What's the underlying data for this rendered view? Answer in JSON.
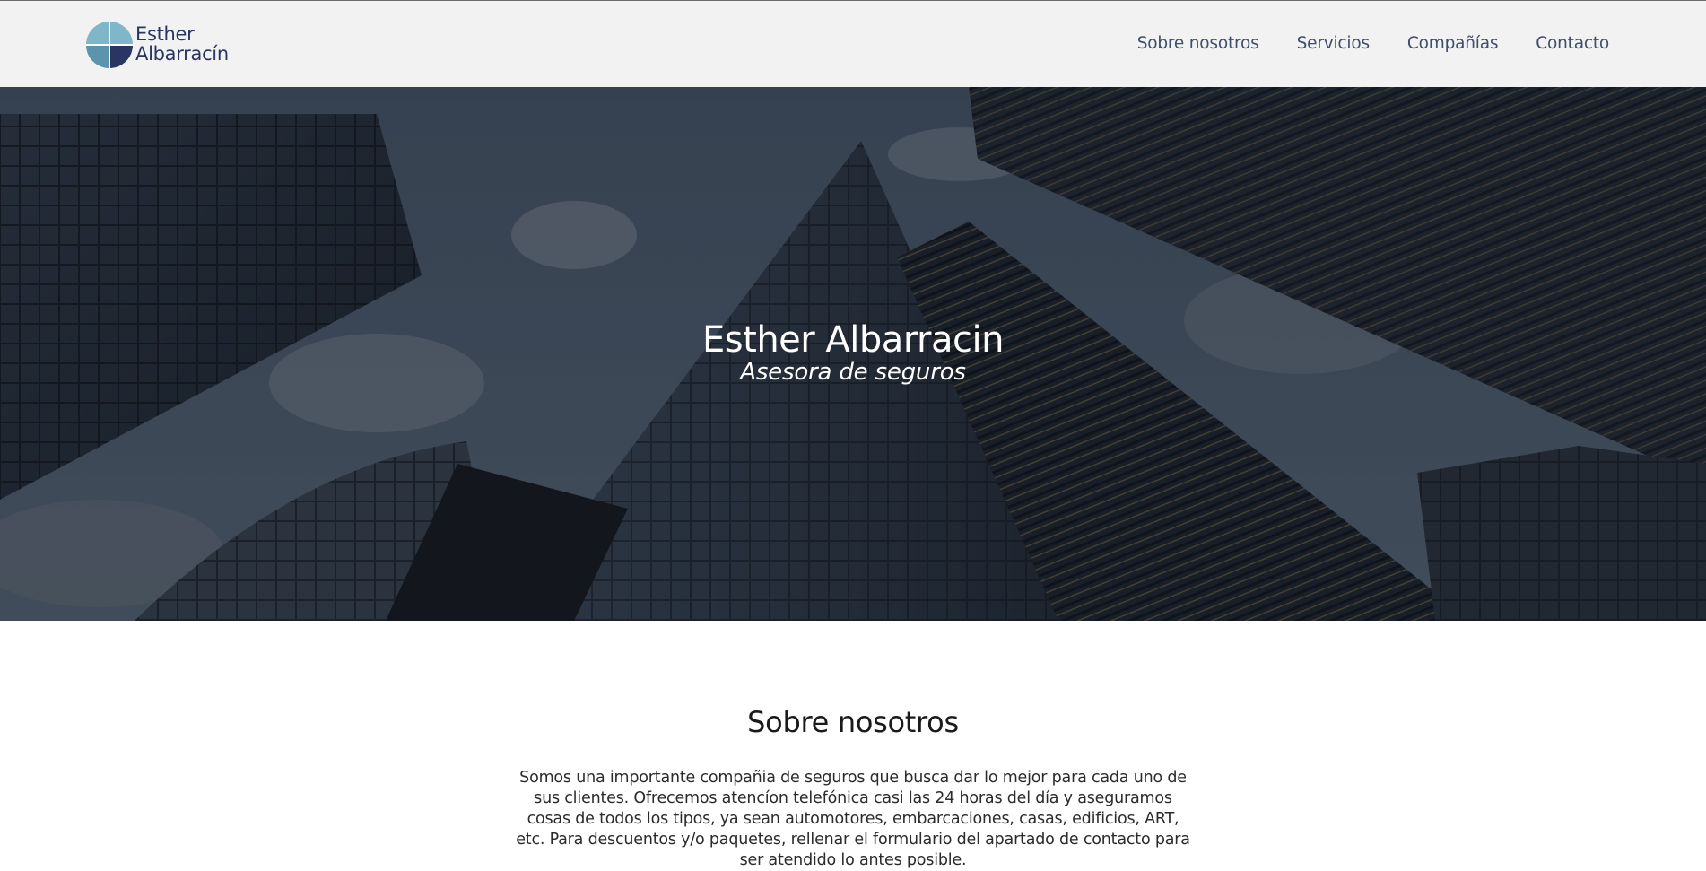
{
  "brand": {
    "line1": "Esther",
    "line2": "Albarracín",
    "color": "#2b3561"
  },
  "nav": {
    "items": [
      {
        "label": "Sobre nosotros"
      },
      {
        "label": "Servicios"
      },
      {
        "label": "Compañías"
      },
      {
        "label": "Contacto"
      }
    ]
  },
  "hero": {
    "title": "Esther Albarracin",
    "subtitle": "Asesora de seguros"
  },
  "about": {
    "title": "Sobre nosotros",
    "text": "Somos una importante compañia de seguros que busca dar lo mejor para cada uno de sus clientes. Ofrecemos atencíon telefónica casi las 24 horas del día y aseguramos cosas de todos los tipos, ya sean automotores, embarcaciones, casas, edificios, ART, etc. Para descuentos y/o paquetes, rellenar el formulario del apartado de contacto para ser atendido lo antes posible."
  },
  "colors": {
    "nav_bg": "#f2f2f2",
    "nav_text": "#3f4d6d",
    "hero_overlay": "#10141c"
  }
}
